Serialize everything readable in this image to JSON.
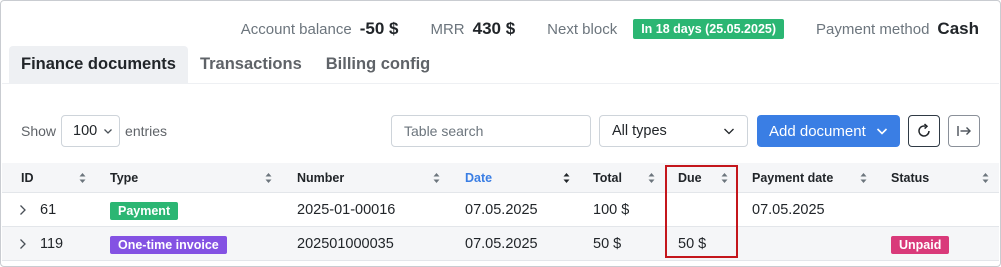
{
  "summary": {
    "balance_label": "Account balance",
    "balance_value": "-50 $",
    "mrr_label": "MRR",
    "mrr_value": "430 $",
    "next_block_label": "Next block",
    "next_block_value": "In 18 days (25.05.2025)",
    "payment_method_label": "Payment method",
    "payment_method_value": "Cash"
  },
  "tabs": [
    {
      "label": "Finance documents",
      "active": true
    },
    {
      "label": "Transactions",
      "active": false
    },
    {
      "label": "Billing config",
      "active": false
    }
  ],
  "controls": {
    "show_label": "Show",
    "entries_value": "100",
    "entries_label": "entries",
    "search_placeholder": "Table search",
    "type_filter": "All types",
    "add_document_label": "Add document"
  },
  "table": {
    "columns": [
      "ID",
      "Type",
      "Number",
      "Date",
      "Total",
      "Due",
      "Payment date",
      "Status"
    ],
    "rows": [
      {
        "id": "61",
        "type": "Payment",
        "number": "2025-01-00016",
        "date": "07.05.2025",
        "total": "100 $",
        "due": "",
        "payment_date": "07.05.2025",
        "status": ""
      },
      {
        "id": "119",
        "type": "One-time invoice",
        "number": "202501000035",
        "date": "07.05.2025",
        "total": "50 $",
        "due": "50 $",
        "payment_date": "",
        "status": "Unpaid"
      }
    ]
  },
  "colors": {
    "accent": "#3a7ee4",
    "success": "#2bb673",
    "purple": "#8452e3",
    "danger": "#d93a7a",
    "highlight": "#c4161c"
  },
  "icons": {
    "search": "search-icon",
    "refresh": "refresh-icon",
    "export": "export-icon",
    "expand": "chevron-right-icon",
    "sort": "sort-icon"
  }
}
